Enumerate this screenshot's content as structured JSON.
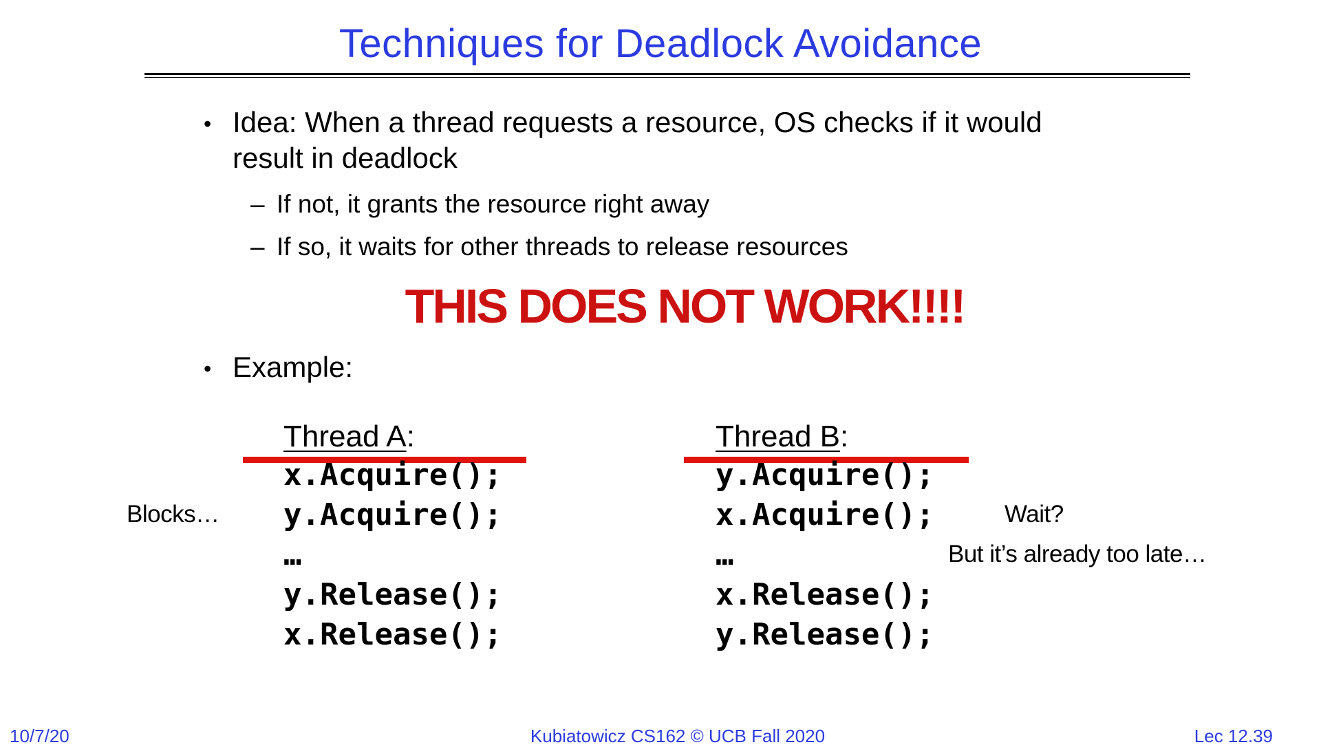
{
  "title": "Techniques for Deadlock Avoidance",
  "bullets": {
    "idea_line1": "Idea: When a thread requests a resource, OS checks if it would",
    "idea_line2": "result in deadlock",
    "sub1": "If not, it grants the resource right away",
    "sub2": "If so, it waits for other threads to release resources",
    "example": "Example:",
    "bullet_glyph": "•",
    "dash_glyph": "–"
  },
  "warning": "THIS DOES NOT WORK!!!!",
  "thread_a": {
    "header": "Thread A",
    "colon": ":",
    "lines": [
      "x.Acquire();",
      "y.Acquire();",
      "…",
      "y.Release();",
      "x.Release();"
    ]
  },
  "thread_b": {
    "header": "Thread B",
    "colon": ":",
    "lines": [
      "y.Acquire();",
      "x.Acquire();",
      "…",
      "x.Release();",
      "y.Release();"
    ]
  },
  "notes": {
    "blocks": "Blocks…",
    "wait": "Wait?",
    "too_late": "But it’s already too late…"
  },
  "footer": {
    "date": "10/7/20",
    "center": "Kubiatowicz CS162 © UCB Fall 2020",
    "lecture": "Lec 12.39"
  },
  "colors": {
    "title": "#2b3be0",
    "warning": "#cc1111",
    "highlight_bar": "#e0140c",
    "footer": "#2b3be0"
  }
}
